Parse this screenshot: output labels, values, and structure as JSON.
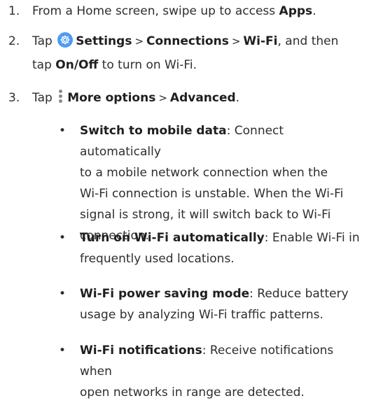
{
  "steps": [
    {
      "number": "1.",
      "prefix": "From a Home screen, swipe up to access ",
      "bold": "Apps",
      "suffix": "."
    },
    {
      "number": "2.",
      "tap": "Tap",
      "icon": "settings-icon",
      "settings": "Settings",
      "sep1": ">",
      "connections": "Connections",
      "sep2": ">",
      "wifi": "Wi-Fi",
      "mid": ", and then",
      "line2_prefix": "tap ",
      "onoff": "On/Off",
      "line2_suffix": " to turn on Wi-Fi."
    },
    {
      "number": "3.",
      "tap": "Tap",
      "icon": "more-options-icon",
      "more": "More options",
      "sep": ">",
      "advanced": "Advanced",
      "suffix": "."
    }
  ],
  "options": [
    {
      "title": "Switch to mobile data",
      "lines": [
        ": Connect automatically",
        "to a mobile network connection when the",
        "Wi-Fi connection is unstable. When the Wi-Fi",
        "signal is strong, it will switch back to Wi-Fi",
        "connection."
      ]
    },
    {
      "title": "Turn on Wi-Fi automatically",
      "lines": [
        ": Enable Wi-Fi in",
        "frequently used locations."
      ]
    },
    {
      "title": "Wi-Fi power saving mode",
      "lines": [
        ": Reduce battery",
        "usage by analyzing Wi-Fi traffic patterns."
      ]
    },
    {
      "title": "Wi-Fi notifications",
      "lines": [
        ": Receive notifications when",
        "open networks in range are detected."
      ]
    }
  ],
  "bullet_char": "•",
  "colors": {
    "text": "#2e2e2e",
    "settings_icon_bg": "#4f9bf2",
    "more_dots": "#8a8a8a"
  }
}
